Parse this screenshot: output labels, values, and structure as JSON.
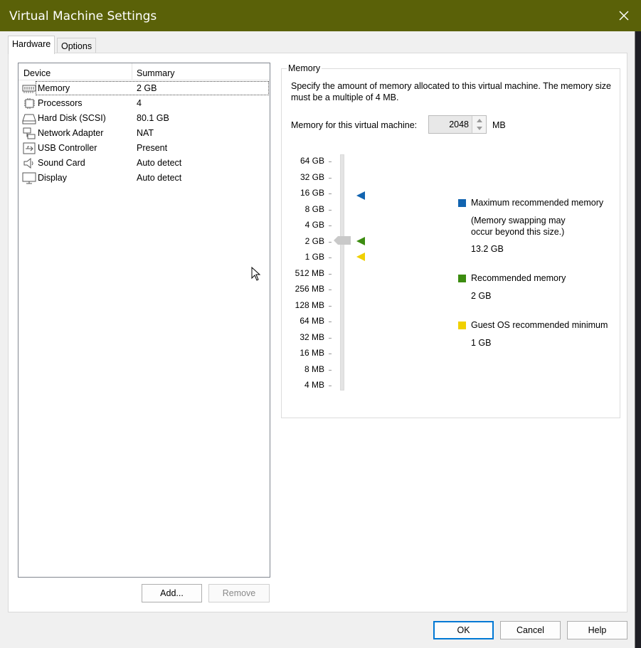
{
  "window": {
    "title": "Virtual Machine Settings"
  },
  "tabs": [
    {
      "label": "Hardware",
      "active": true
    },
    {
      "label": "Options",
      "active": false
    }
  ],
  "devices": {
    "header": {
      "device": "Device",
      "summary": "Summary"
    },
    "rows": [
      {
        "name": "Memory",
        "summary": "2 GB",
        "icon": "memory-icon",
        "selected": true
      },
      {
        "name": "Processors",
        "summary": "4",
        "icon": "processor-icon"
      },
      {
        "name": "Hard Disk (SCSI)",
        "summary": "80.1 GB",
        "icon": "hard-disk-icon"
      },
      {
        "name": "Network Adapter",
        "summary": "NAT",
        "icon": "network-adapter-icon"
      },
      {
        "name": "USB Controller",
        "summary": "Present",
        "icon": "usb-icon"
      },
      {
        "name": "Sound Card",
        "summary": "Auto detect",
        "icon": "speaker-icon"
      },
      {
        "name": "Display",
        "summary": "Auto detect",
        "icon": "monitor-icon"
      }
    ],
    "add_label": "Add...",
    "remove_label": "Remove"
  },
  "memory": {
    "group_title": "Memory",
    "description": "Specify the amount of memory allocated to this virtual machine. The memory size must be a multiple of 4 MB.",
    "field_label": "Memory for this virtual machine:",
    "value": "2048",
    "unit": "MB",
    "scale": [
      "64 GB",
      "32 GB",
      "16 GB",
      "8 GB",
      "4 GB",
      "2 GB",
      "1 GB",
      "512 MB",
      "256 MB",
      "128 MB",
      "64 MB",
      "32 MB",
      "16 MB",
      "8 MB",
      "4 MB"
    ],
    "slider_value": "2 GB",
    "legend": {
      "max": {
        "label": "Maximum recommended memory",
        "note1": "(Memory swapping may",
        "note2": "occur beyond this size.)",
        "value": "13.2 GB",
        "color": "#1264b0"
      },
      "recommended": {
        "label": "Recommended memory",
        "value": "2 GB",
        "color": "#3c8c10"
      },
      "minimum": {
        "label": "Guest OS recommended minimum",
        "value": "1 GB",
        "color": "#f0d000"
      }
    }
  },
  "footer": {
    "ok_label": "OK",
    "cancel_label": "Cancel",
    "help_label": "Help"
  }
}
